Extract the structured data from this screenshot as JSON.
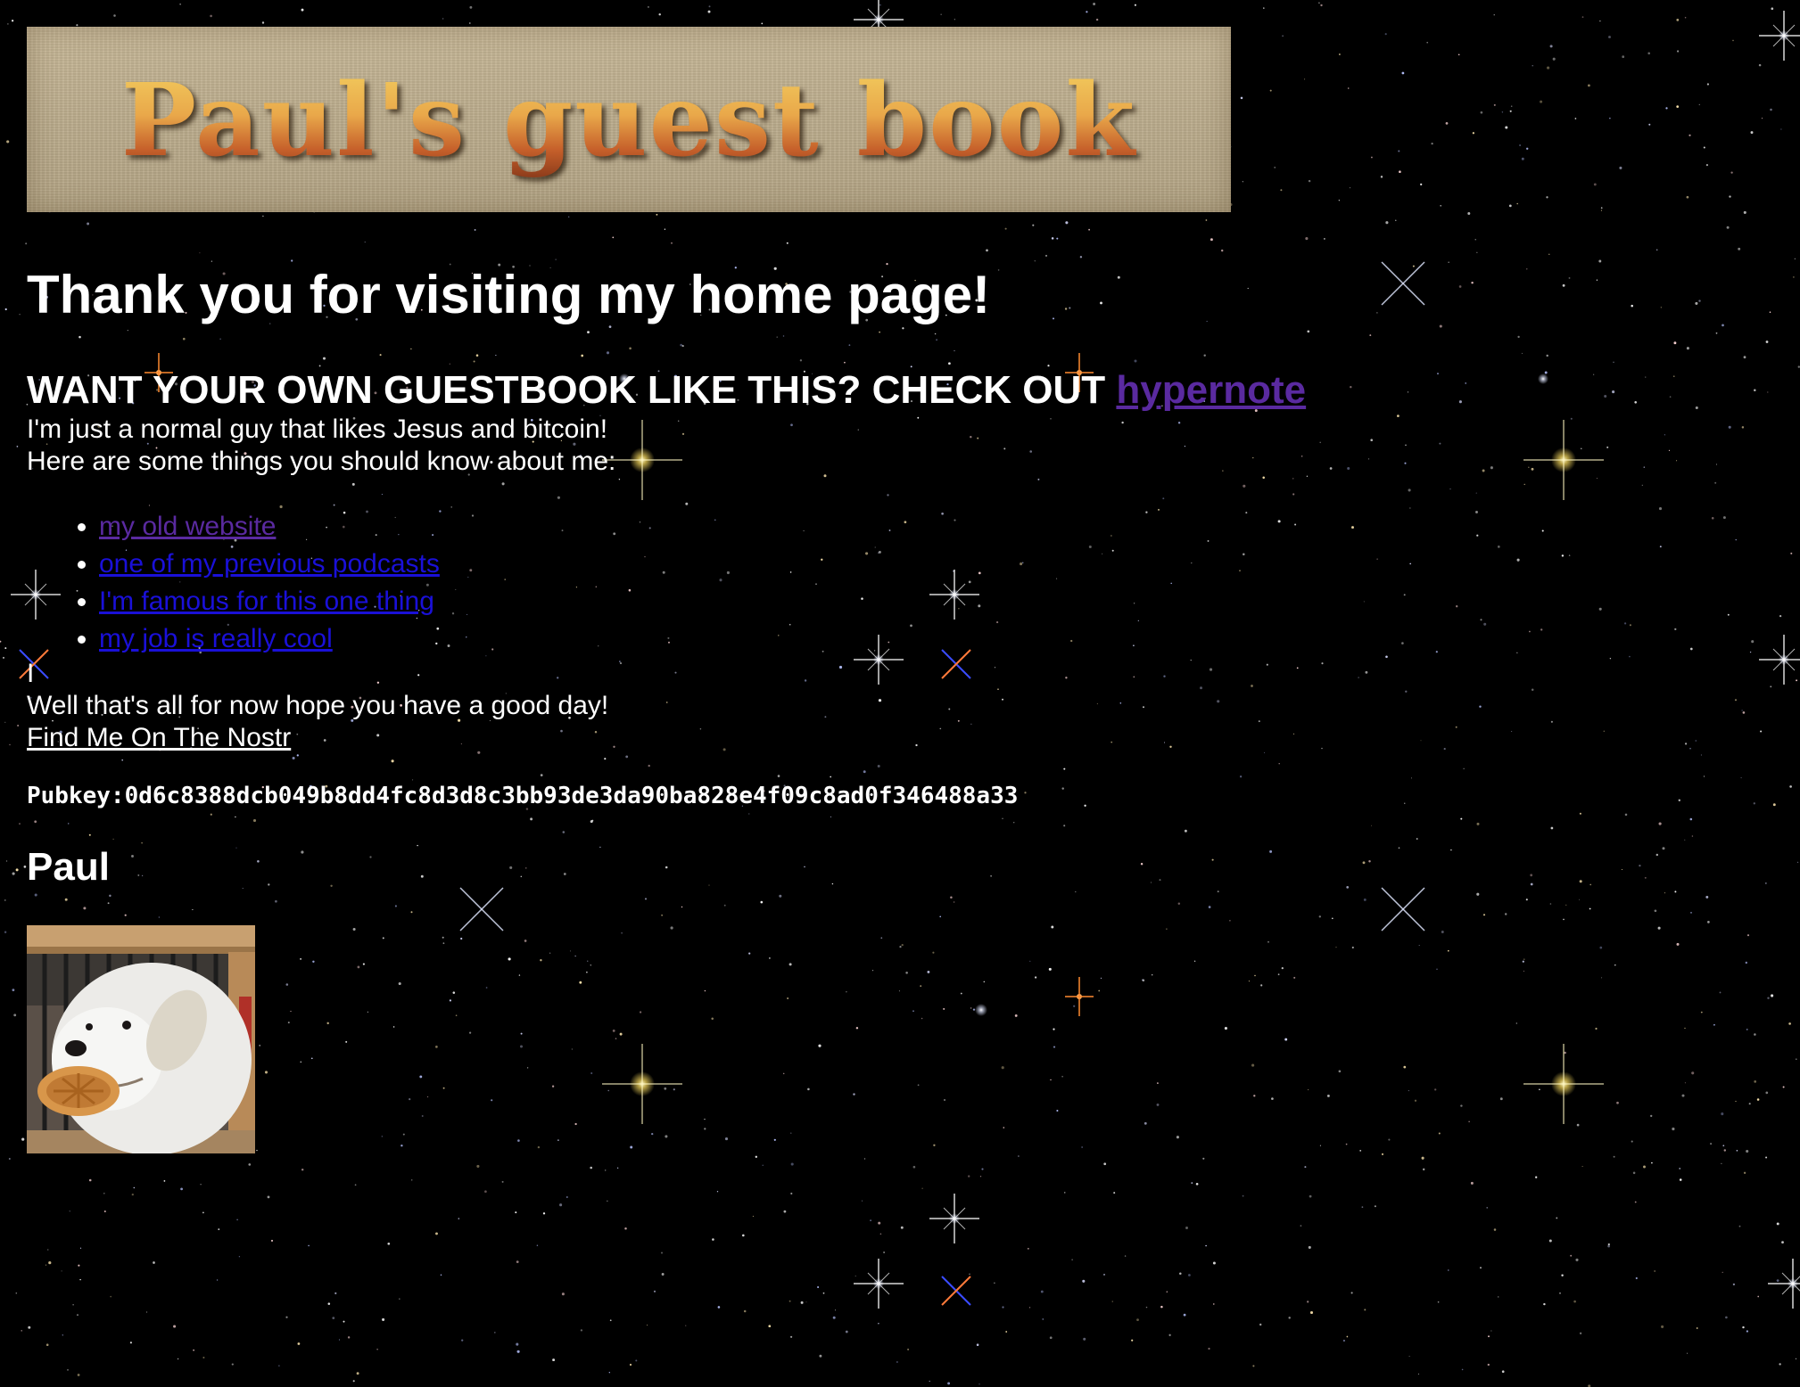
{
  "banner": {
    "title": "Paul's guest book"
  },
  "greeting": "Thank you for visiting my home page!",
  "cta": {
    "prefix": "WANT YOUR OWN GUESTBOOK LIKE THIS? CHECK OUT ",
    "link_label": "hypernote"
  },
  "intro": "I'm just a normal guy that likes Jesus and bitcoin!",
  "things_heading": "Here are some things you should know about me:",
  "things": [
    {
      "label": "my old website"
    },
    {
      "label": "one of my previous podcasts"
    },
    {
      "label": "I'm famous for this one thing"
    },
    {
      "label": "my job is really cool"
    }
  ],
  "cursor_line": "I",
  "farewell": "Well that's all for now hope you have a good day!",
  "nostr_link": "Find Me On The Nostr",
  "pubkey": "Pubkey:0d6c8388dcb049b8dd4fc8d3d8c3bb93de3da90ba828e4f09c8ad0f346488a33",
  "signature": "Paul",
  "colors": {
    "background": "#000000",
    "text": "#ffffff",
    "visited_link": "#5a2aa0",
    "unvisited_link": "#1a10d8",
    "banner_bg": "#c2b392",
    "banner_text": "#e9a84a"
  },
  "avatar": {
    "icon": "dog-with-waffle-photo"
  }
}
